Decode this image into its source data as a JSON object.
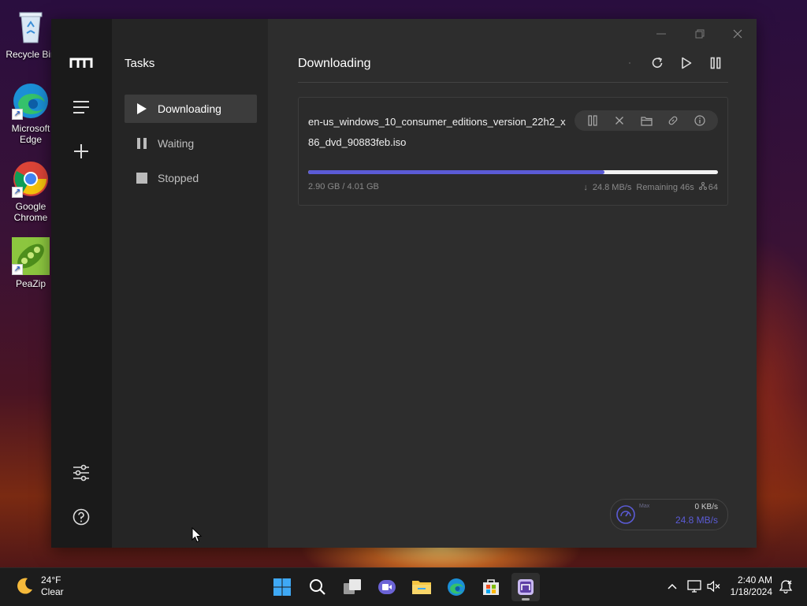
{
  "desktop": {
    "icons": [
      {
        "label": "Recycle Bin"
      },
      {
        "label": "Microsoft Edge"
      },
      {
        "label": "Google Chrome"
      },
      {
        "label": "PeaZip"
      }
    ]
  },
  "app": {
    "sidebar": {
      "title": "Tasks",
      "items": [
        {
          "label": "Downloading",
          "active": true
        },
        {
          "label": "Waiting",
          "active": false
        },
        {
          "label": "Stopped",
          "active": false
        }
      ]
    },
    "main": {
      "title": "Downloading",
      "tasks": [
        {
          "name": "en-us_windows_10_consumer_editions_version_22h2_x86_dvd_90883feb.iso",
          "size": "2.90 GB / 4.01 GB",
          "progress": 0.723,
          "speed": "24.8 MB/s",
          "remaining": "Remaining 46s",
          "connections": "64"
        }
      ]
    },
    "speedometer": {
      "label": "Max",
      "upload": "0 KB/s",
      "download": "24.8 MB/s"
    }
  },
  "taskbar": {
    "weather": {
      "temp": "24°F",
      "condition": "Clear"
    },
    "clock": {
      "time": "2:40 AM",
      "date": "1/18/2024"
    }
  },
  "colors": {
    "accent": "#5b5bd6",
    "rail_bg": "#1a1a1a",
    "subnav_bg": "#252525",
    "main_bg": "#2d2d2d"
  }
}
